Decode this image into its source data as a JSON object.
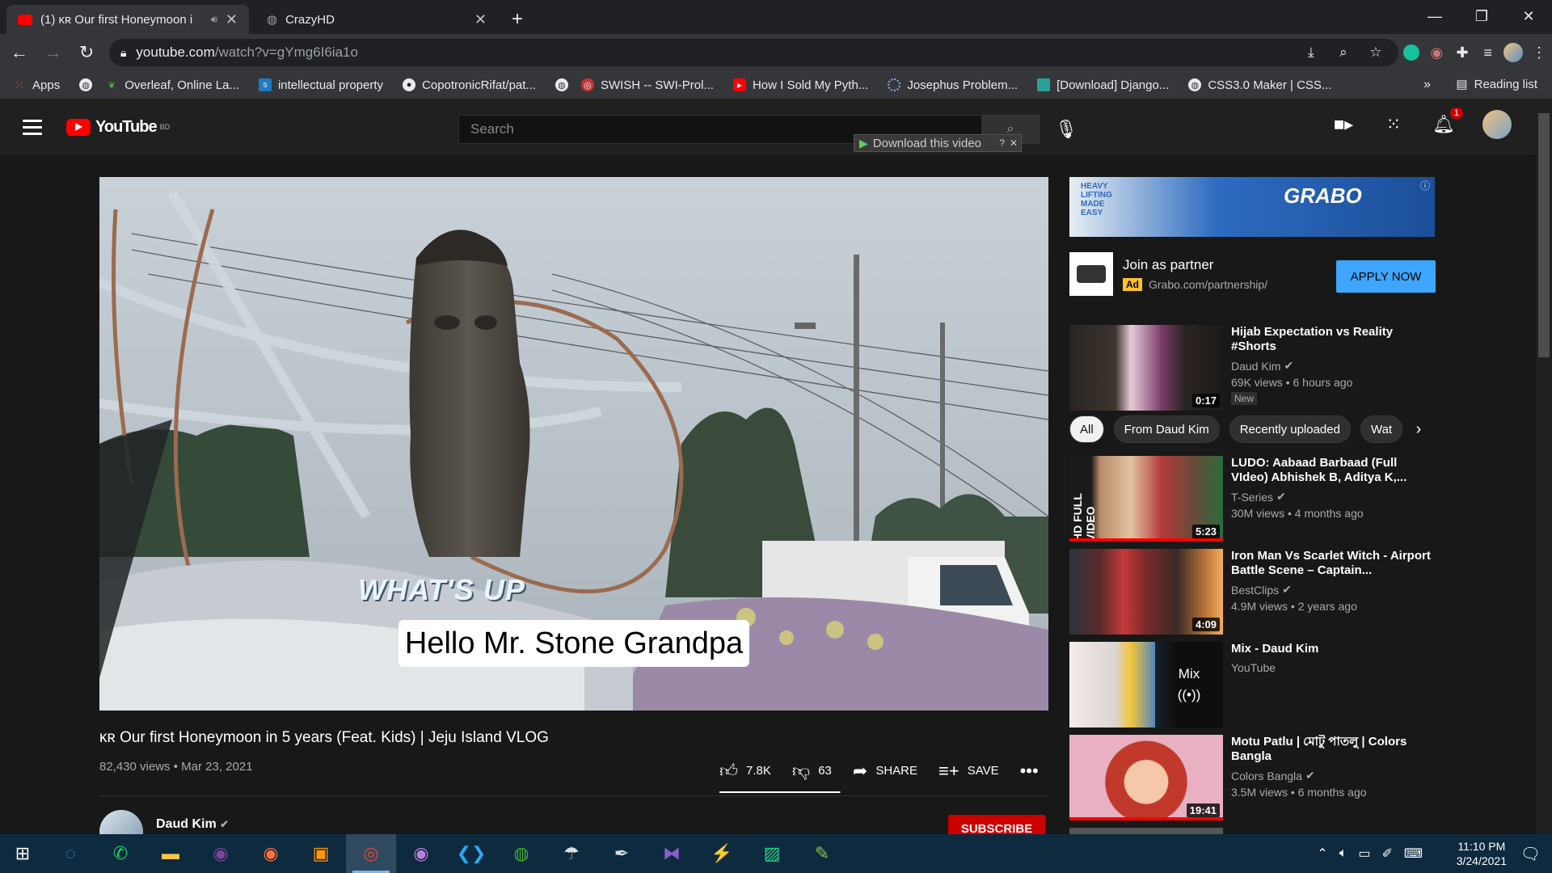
{
  "browser": {
    "tabs": [
      {
        "title": "(1) ᴋʀ Our first Honeymoon i",
        "active": true,
        "icon": "youtube-icon"
      },
      {
        "title": "CrazyHD",
        "active": false,
        "icon": "globe-icon"
      }
    ],
    "url_host": "youtube.com",
    "url_path": "/watch?v=gYmg6I6ia1o",
    "bookmarks": [
      {
        "label": "Apps",
        "icon": "apps-grid-icon"
      },
      {
        "label": "",
        "icon": "globe-icon"
      },
      {
        "label": "Overleaf, Online La...",
        "icon": "overleaf-icon"
      },
      {
        "label": "intellectual property",
        "icon": "scribd-icon"
      },
      {
        "label": "CopotronicRifat/pat...",
        "icon": "github-icon"
      },
      {
        "label": "",
        "icon": "globe-icon"
      },
      {
        "label": "SWISH -- SWI-Prol...",
        "icon": "swish-icon"
      },
      {
        "label": "How I Sold My Pyth...",
        "icon": "youtube-icon"
      },
      {
        "label": "Josephus Problem...",
        "icon": "loading-icon"
      },
      {
        "label": "[Download] Django...",
        "icon": "site-icon"
      },
      {
        "label": "CSS3.0 Maker | CSS...",
        "icon": "globe-icon"
      }
    ],
    "bookmarks_more": "»",
    "reading_list": "Reading list"
  },
  "youtube": {
    "logo_text": "YouTube",
    "logo_region": "BD",
    "search_placeholder": "Search",
    "download_overlay": "Download this video",
    "notification_count": "1"
  },
  "video": {
    "caption_top": "WHAT'S UP",
    "caption_box": "Hello Mr. Stone Grandpa",
    "title": "ᴋʀ Our first Honeymoon in 5 years (Feat. Kids) | Jeju Island VLOG",
    "views": "82,430 views",
    "date": "Mar 23, 2021",
    "likes": "7.8K",
    "dislikes": "63",
    "like_ratio": 0.99,
    "share_label": "SHARE",
    "save_label": "SAVE",
    "channel": "Daud Kim",
    "subscribe_label": "SUBSCRIBE"
  },
  "ad": {
    "banner_brand": "GRABO",
    "banner_tagline": "HEAVY LIFTING MADE EASY",
    "title": "Join as partner",
    "badge": "Ad",
    "url": "Grabo.com/partnership/",
    "cta": "APPLY NOW"
  },
  "chips": [
    "All",
    "From Daud Kim",
    "Recently uploaded",
    "Wat"
  ],
  "recommendations": [
    {
      "title": "Hijab Expectation vs Reality #Shorts",
      "channel": "Daud Kim",
      "verified": true,
      "meta": "69K views • 6 hours ago",
      "badge": "New",
      "duration": "0:17",
      "progress": 0
    },
    {
      "title": "LUDO: Aabaad Barbaad (Full VIdeo) Abhishek B, Aditya K,...",
      "channel": "T-Series",
      "verified": true,
      "meta": "30M views • 4 months ago",
      "duration": "5:23",
      "progress": 1.0
    },
    {
      "title": "Iron Man Vs Scarlet Witch - Airport Battle Scene – Captain...",
      "channel": "BestClips",
      "verified": true,
      "meta": "4.9M views • 2 years ago",
      "duration": "4:09",
      "progress": 0
    },
    {
      "title": "Mix - Daud Kim",
      "channel": "YouTube",
      "verified": false,
      "meta": "",
      "mix_label": "Mix",
      "duration": "",
      "progress": 0
    },
    {
      "title": "Motu Patlu | মোটু পাতলু | Colors Bangla",
      "channel": "Colors Bangla",
      "verified": true,
      "meta": "3.5M views • 6 months ago",
      "duration": "19:41",
      "progress": 1.0
    }
  ],
  "taskbar": {
    "time": "11:10 PM",
    "date": "3/24/2021",
    "apps": [
      "windows-start",
      "zoom",
      "whatsapp",
      "file-explorer",
      "tor",
      "firefox",
      "sublime",
      "chrome",
      "github-desktop",
      "vscode",
      "anaconda",
      "uget",
      "inkscape",
      "visual-studio",
      "messenger",
      "pycharm",
      "notepad"
    ]
  },
  "colors": {
    "youtube_red": "#ff0000",
    "subscribe_red": "#cc0000",
    "apply_blue": "#3ea6ff",
    "ad_yellow": "#fbc02d",
    "taskbar": "#0d2a3f"
  }
}
